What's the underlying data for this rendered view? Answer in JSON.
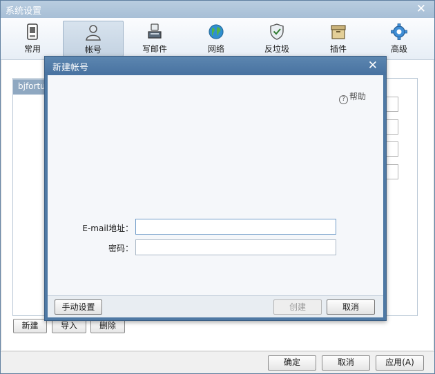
{
  "main_window": {
    "title": "系统设置",
    "close_glyph": "✕"
  },
  "toolbar": {
    "items": [
      {
        "label": "常用",
        "icon": "phone-icon"
      },
      {
        "label": "帐号",
        "icon": "user-icon"
      },
      {
        "label": "写邮件",
        "icon": "compose-icon"
      },
      {
        "label": "网络",
        "icon": "globe-icon"
      },
      {
        "label": "反垃圾",
        "icon": "shield-icon"
      },
      {
        "label": "插件",
        "icon": "box-icon"
      },
      {
        "label": "高级",
        "icon": "gear-icon"
      }
    ],
    "active_index": 1
  },
  "account_list": {
    "items": [
      "bjfortu"
    ]
  },
  "list_actions": {
    "new_label": "新建",
    "import_label": "导入",
    "delete_label": "删除"
  },
  "bottom_buttons": {
    "ok_label": "确定",
    "cancel_label": "取消",
    "apply_label": "应用(A)"
  },
  "dialog": {
    "title": "新建帐号",
    "close_glyph": "✕",
    "help_label": "帮助",
    "help_glyph": "?",
    "email_label": "E-mail地址：",
    "email_value": "",
    "password_label": "密码：",
    "password_value": "",
    "manual_setup_label": "手动设置",
    "create_label": "创建",
    "cancel_label": "取消"
  },
  "colors": {
    "dialog_frame": "#4f79a4",
    "main_titlebar": "#a7bfd6",
    "active_tab": "#c4d3e2"
  }
}
